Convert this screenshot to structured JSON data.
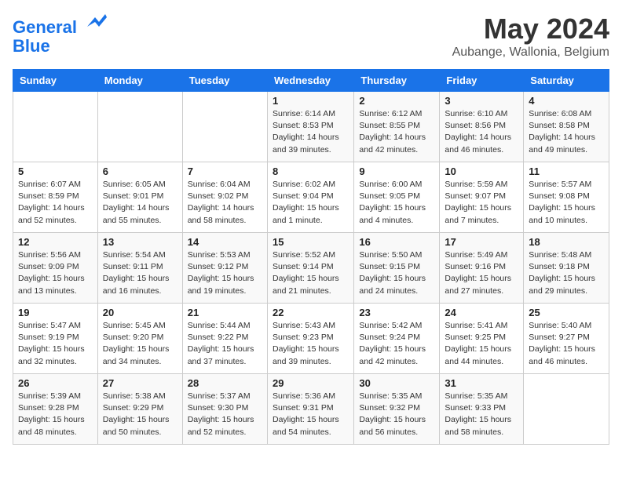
{
  "logo": {
    "line1": "General",
    "line2": "Blue"
  },
  "title": "May 2024",
  "location": "Aubange, Wallonia, Belgium",
  "headers": [
    "Sunday",
    "Monday",
    "Tuesday",
    "Wednesday",
    "Thursday",
    "Friday",
    "Saturday"
  ],
  "weeks": [
    [
      {
        "day": "",
        "info": ""
      },
      {
        "day": "",
        "info": ""
      },
      {
        "day": "",
        "info": ""
      },
      {
        "day": "1",
        "info": "Sunrise: 6:14 AM\nSunset: 8:53 PM\nDaylight: 14 hours\nand 39 minutes."
      },
      {
        "day": "2",
        "info": "Sunrise: 6:12 AM\nSunset: 8:55 PM\nDaylight: 14 hours\nand 42 minutes."
      },
      {
        "day": "3",
        "info": "Sunrise: 6:10 AM\nSunset: 8:56 PM\nDaylight: 14 hours\nand 46 minutes."
      },
      {
        "day": "4",
        "info": "Sunrise: 6:08 AM\nSunset: 8:58 PM\nDaylight: 14 hours\nand 49 minutes."
      }
    ],
    [
      {
        "day": "5",
        "info": "Sunrise: 6:07 AM\nSunset: 8:59 PM\nDaylight: 14 hours\nand 52 minutes."
      },
      {
        "day": "6",
        "info": "Sunrise: 6:05 AM\nSunset: 9:01 PM\nDaylight: 14 hours\nand 55 minutes."
      },
      {
        "day": "7",
        "info": "Sunrise: 6:04 AM\nSunset: 9:02 PM\nDaylight: 14 hours\nand 58 minutes."
      },
      {
        "day": "8",
        "info": "Sunrise: 6:02 AM\nSunset: 9:04 PM\nDaylight: 15 hours\nand 1 minute."
      },
      {
        "day": "9",
        "info": "Sunrise: 6:00 AM\nSunset: 9:05 PM\nDaylight: 15 hours\nand 4 minutes."
      },
      {
        "day": "10",
        "info": "Sunrise: 5:59 AM\nSunset: 9:07 PM\nDaylight: 15 hours\nand 7 minutes."
      },
      {
        "day": "11",
        "info": "Sunrise: 5:57 AM\nSunset: 9:08 PM\nDaylight: 15 hours\nand 10 minutes."
      }
    ],
    [
      {
        "day": "12",
        "info": "Sunrise: 5:56 AM\nSunset: 9:09 PM\nDaylight: 15 hours\nand 13 minutes."
      },
      {
        "day": "13",
        "info": "Sunrise: 5:54 AM\nSunset: 9:11 PM\nDaylight: 15 hours\nand 16 minutes."
      },
      {
        "day": "14",
        "info": "Sunrise: 5:53 AM\nSunset: 9:12 PM\nDaylight: 15 hours\nand 19 minutes."
      },
      {
        "day": "15",
        "info": "Sunrise: 5:52 AM\nSunset: 9:14 PM\nDaylight: 15 hours\nand 21 minutes."
      },
      {
        "day": "16",
        "info": "Sunrise: 5:50 AM\nSunset: 9:15 PM\nDaylight: 15 hours\nand 24 minutes."
      },
      {
        "day": "17",
        "info": "Sunrise: 5:49 AM\nSunset: 9:16 PM\nDaylight: 15 hours\nand 27 minutes."
      },
      {
        "day": "18",
        "info": "Sunrise: 5:48 AM\nSunset: 9:18 PM\nDaylight: 15 hours\nand 29 minutes."
      }
    ],
    [
      {
        "day": "19",
        "info": "Sunrise: 5:47 AM\nSunset: 9:19 PM\nDaylight: 15 hours\nand 32 minutes."
      },
      {
        "day": "20",
        "info": "Sunrise: 5:45 AM\nSunset: 9:20 PM\nDaylight: 15 hours\nand 34 minutes."
      },
      {
        "day": "21",
        "info": "Sunrise: 5:44 AM\nSunset: 9:22 PM\nDaylight: 15 hours\nand 37 minutes."
      },
      {
        "day": "22",
        "info": "Sunrise: 5:43 AM\nSunset: 9:23 PM\nDaylight: 15 hours\nand 39 minutes."
      },
      {
        "day": "23",
        "info": "Sunrise: 5:42 AM\nSunset: 9:24 PM\nDaylight: 15 hours\nand 42 minutes."
      },
      {
        "day": "24",
        "info": "Sunrise: 5:41 AM\nSunset: 9:25 PM\nDaylight: 15 hours\nand 44 minutes."
      },
      {
        "day": "25",
        "info": "Sunrise: 5:40 AM\nSunset: 9:27 PM\nDaylight: 15 hours\nand 46 minutes."
      }
    ],
    [
      {
        "day": "26",
        "info": "Sunrise: 5:39 AM\nSunset: 9:28 PM\nDaylight: 15 hours\nand 48 minutes."
      },
      {
        "day": "27",
        "info": "Sunrise: 5:38 AM\nSunset: 9:29 PM\nDaylight: 15 hours\nand 50 minutes."
      },
      {
        "day": "28",
        "info": "Sunrise: 5:37 AM\nSunset: 9:30 PM\nDaylight: 15 hours\nand 52 minutes."
      },
      {
        "day": "29",
        "info": "Sunrise: 5:36 AM\nSunset: 9:31 PM\nDaylight: 15 hours\nand 54 minutes."
      },
      {
        "day": "30",
        "info": "Sunrise: 5:35 AM\nSunset: 9:32 PM\nDaylight: 15 hours\nand 56 minutes."
      },
      {
        "day": "31",
        "info": "Sunrise: 5:35 AM\nSunset: 9:33 PM\nDaylight: 15 hours\nand 58 minutes."
      },
      {
        "day": "",
        "info": ""
      }
    ]
  ]
}
